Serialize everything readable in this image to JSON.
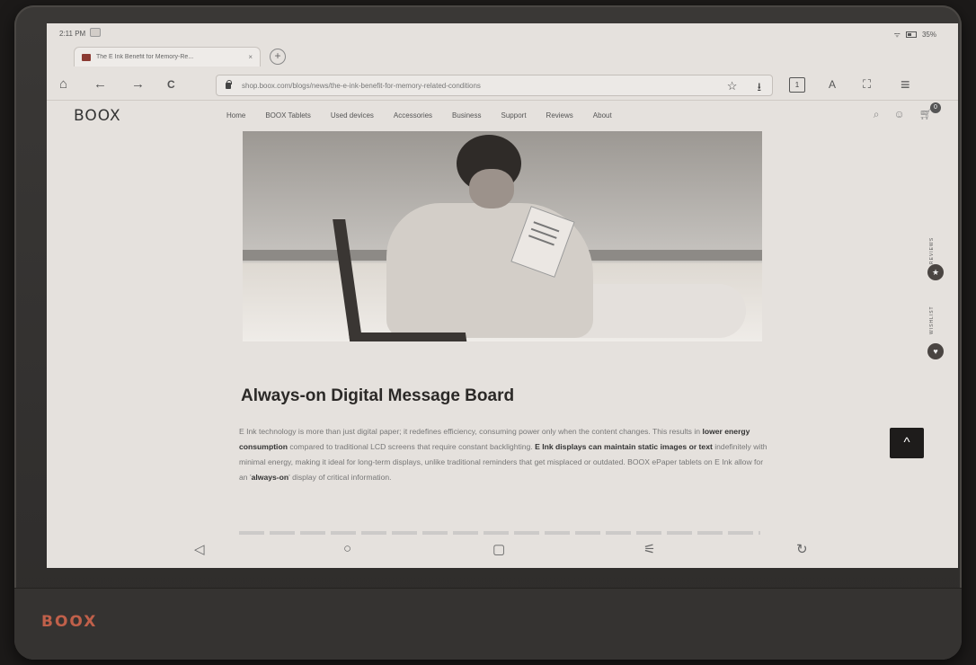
{
  "status": {
    "time": "2:11 PM",
    "battery": "35%"
  },
  "tab": {
    "title": "The E Ink Benefit for Memory-Re...",
    "close": "×"
  },
  "new_tab": "+",
  "toolbar": {
    "home": "⌂",
    "back": "←",
    "forward": "→",
    "reload": "C",
    "url": "shop.boox.com/blogs/news/the-e-ink-benefit-for-memory-related-conditions",
    "star": "☆",
    "download": "⭳",
    "tab_count": "1",
    "reader": "A",
    "fullscreen": "⛶",
    "menu": "≡"
  },
  "site": {
    "logo": "BOOX",
    "nav": [
      "Home",
      "BOOX Tablets",
      "Used devices",
      "Accessories",
      "Business",
      "Support",
      "Reviews",
      "About"
    ],
    "cart_count": "0"
  },
  "side": {
    "reviews": "REVIEWS",
    "wishlist": "WISHLIST"
  },
  "article": {
    "title": "Always-on Digital Message Board",
    "p1": "E Ink technology is more than just digital paper; it redefines efficiency, consuming power only when the content changes. This results in ",
    "b1": "lower energy consumption",
    "p2": " compared to traditional LCD screens that require constant backlighting. ",
    "b2": "E Ink displays can maintain static images or text",
    "p3": " indefinitely with minimal energy, making it ideal for long-term displays, unlike traditional reminders that get misplaced or outdated. BOOX ePaper tablets on E Ink allow for an '",
    "b3": "always-on",
    "p4": "' display of critical information."
  },
  "scroll_top": "^",
  "navbar": {
    "back": "◁",
    "home": "○",
    "recents": "▢",
    "settings": "⚟",
    "refresh": "↻"
  },
  "device_logo": "BOOX",
  "colors": {
    "screen": "#e5e1dd",
    "accent": "#c0604a",
    "dark": "#1e1c1b"
  }
}
